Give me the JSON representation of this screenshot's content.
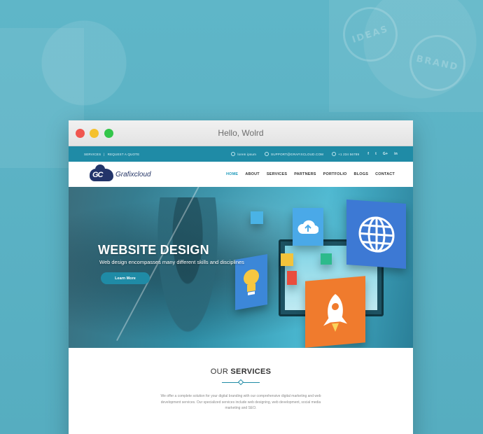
{
  "window": {
    "title": "Hello, Wolrd"
  },
  "topbar": {
    "links": [
      "SERVICES",
      "|",
      "REQUEST A QUOTE"
    ],
    "location": "lorem ipsum",
    "email": "SUPPORT@GRAFIXCLOUD.COM",
    "phone": "+1 234 56789",
    "social": [
      "f",
      "t",
      "G+",
      "in"
    ]
  },
  "brand": {
    "mark": "GC",
    "name": "Grafixcloud"
  },
  "nav": [
    "HOME",
    "ABOUT",
    "SERVICES",
    "PARTNERS",
    "PORTFOLIO",
    "BLOGS",
    "CONTACT"
  ],
  "hero": {
    "title": "WEBSITE DESIGN",
    "subtitle": "Web design encompasses many different skills and disciplines",
    "cta": "Learn More"
  },
  "services": {
    "title_light": "OUR ",
    "title_bold": "SERVICES",
    "body": "We offer a complete solution for your digital branding with our comprehensive digital marketing and web development services. Our specialized services include web designing, web development, social media marketing and SEO."
  },
  "background": {
    "stamps": [
      "IDEAS",
      "BRAND"
    ]
  },
  "colors": {
    "accent": "#1f8ba6",
    "background": "#5bb2c4"
  }
}
